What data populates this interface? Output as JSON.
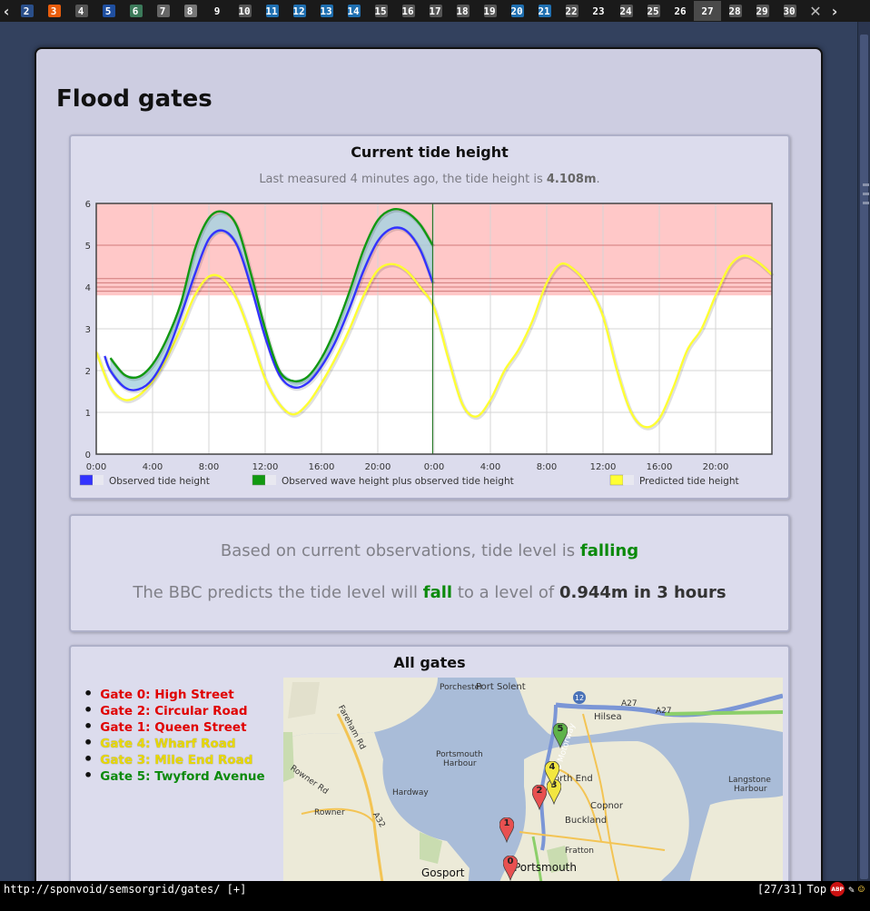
{
  "tabs": [
    {
      "num": "2",
      "fav": "#2a4f8a"
    },
    {
      "num": "3",
      "fav": "#e85d0c"
    },
    {
      "num": "4",
      "fav": "#555"
    },
    {
      "num": "5",
      "fav": "#1f4fa0"
    },
    {
      "num": "6",
      "fav": "#3c7a5a"
    },
    {
      "num": "7",
      "fav": "#666"
    },
    {
      "num": "8",
      "fav": "#777"
    },
    {
      "num": "9",
      "fav": ""
    },
    {
      "num": "10",
      "fav": "#555"
    },
    {
      "num": "11",
      "fav": "#1f6fb0"
    },
    {
      "num": "12",
      "fav": "#1f6fb0"
    },
    {
      "num": "13",
      "fav": "#1f6fb0"
    },
    {
      "num": "14",
      "fav": "#1f6fb0"
    },
    {
      "num": "15",
      "fav": "#555"
    },
    {
      "num": "16",
      "fav": "#555"
    },
    {
      "num": "17",
      "fav": "#555"
    },
    {
      "num": "18",
      "fav": "#555"
    },
    {
      "num": "19",
      "fav": "#555"
    },
    {
      "num": "20",
      "fav": "#1f6fb0"
    },
    {
      "num": "21",
      "fav": "#1f6fb0"
    },
    {
      "num": "22",
      "fav": "#555"
    },
    {
      "num": "23",
      "fav": ""
    },
    {
      "num": "24",
      "fav": "#555"
    },
    {
      "num": "25",
      "fav": "#555"
    },
    {
      "num": "26",
      "fav": ""
    },
    {
      "num": "27",
      "fav": "",
      "active": true
    },
    {
      "num": "28",
      "fav": "#555"
    },
    {
      "num": "29",
      "fav": "#555"
    },
    {
      "num": "30",
      "fav": "#555"
    }
  ],
  "page_title": "Flood gates",
  "tide": {
    "title": "Current tide height",
    "sub_prefix": "Last measured 4 minutes ago, the tide height is ",
    "sub_value": "4.108m",
    "sub_suffix": "."
  },
  "chart_data": {
    "type": "line",
    "ylim": [
      0,
      6
    ],
    "xlim": [
      0,
      48
    ],
    "x_unit": "hours from 0:00 on day 1",
    "xticks": [
      0,
      4,
      8,
      12,
      16,
      20,
      24,
      28,
      32,
      36,
      40,
      44
    ],
    "xtick_labels": [
      "0:00",
      "4:00",
      "8:00",
      "12:00",
      "16:00",
      "20:00",
      "0:00",
      "4:00",
      "8:00",
      "12:00",
      "16:00",
      "20:00"
    ],
    "yticks": [
      0,
      1,
      2,
      3,
      4,
      5,
      6
    ],
    "grid": true,
    "now_marker_x": 23.9,
    "danger_zone_from": 3.8,
    "threshold_lines": [
      5.0,
      4.2,
      4.1,
      4.0,
      3.9
    ],
    "legend_position": "bottom",
    "series": [
      {
        "name": "Predicted tide height",
        "color": "#ffff33",
        "x": [
          0,
          1,
          2,
          3,
          4,
          5,
          6,
          7,
          8,
          9,
          10,
          11,
          12,
          13,
          14,
          15,
          16,
          17,
          18,
          19,
          20,
          21,
          22,
          23,
          24,
          25,
          26,
          27,
          28,
          29,
          30,
          31,
          32,
          33,
          34,
          35,
          36,
          37,
          38,
          39,
          40,
          41,
          42,
          43,
          44,
          45,
          46,
          47,
          48
        ],
        "y": [
          2.45,
          1.6,
          1.3,
          1.4,
          1.75,
          2.3,
          3.0,
          3.8,
          4.25,
          4.2,
          3.7,
          2.8,
          1.8,
          1.2,
          0.95,
          1.2,
          1.7,
          2.3,
          3.0,
          3.8,
          4.4,
          4.55,
          4.4,
          4.0,
          3.5,
          2.3,
          1.2,
          0.9,
          1.3,
          2.0,
          2.5,
          3.2,
          4.1,
          4.55,
          4.4,
          4.0,
          3.3,
          2.0,
          1.0,
          0.65,
          0.85,
          1.6,
          2.5,
          3.0,
          3.8,
          4.5,
          4.75,
          4.6,
          4.3
        ]
      },
      {
        "name": "Observed tide height",
        "color": "#3333ff",
        "x": [
          0.6,
          1,
          2,
          3,
          4,
          5,
          6,
          7,
          8,
          9,
          10,
          11,
          12,
          13,
          14,
          15,
          16,
          17,
          18,
          19,
          20,
          21,
          22,
          23,
          23.9
        ],
        "y": [
          2.35,
          2.0,
          1.6,
          1.55,
          1.8,
          2.4,
          3.3,
          4.3,
          5.15,
          5.35,
          5.0,
          4.0,
          2.8,
          1.9,
          1.6,
          1.7,
          2.1,
          2.7,
          3.5,
          4.4,
          5.1,
          5.4,
          5.35,
          4.9,
          4.108
        ]
      },
      {
        "name": "Observed wave height plus observed tide height",
        "color": "#119911",
        "x": [
          1,
          2,
          3,
          4,
          5,
          6,
          7,
          8,
          9,
          10,
          11,
          12,
          13,
          14,
          15,
          16,
          17,
          18,
          19,
          20,
          21,
          22,
          23,
          23.9
        ],
        "y": [
          2.3,
          1.9,
          1.85,
          2.15,
          2.75,
          3.6,
          4.9,
          5.65,
          5.8,
          5.45,
          4.3,
          3.0,
          2.0,
          1.75,
          1.85,
          2.3,
          3.0,
          3.9,
          4.9,
          5.6,
          5.85,
          5.8,
          5.5,
          5.0
        ]
      }
    ],
    "legend": [
      {
        "label": "Observed tide height",
        "color": "#3333ff"
      },
      {
        "label": "Observed wave height plus observed tide height",
        "color": "#119911"
      },
      {
        "label": "Predicted tide height",
        "color": "#ffff33"
      }
    ]
  },
  "status": {
    "line1_prefix": "Based on current observations, tide level is ",
    "line1_value": "falling",
    "line2_prefix": "The BBC predicts the tide level will ",
    "line2_verb": "fall",
    "line2_middle": " to a level of ",
    "line2_value": "0.944m in 3 hours"
  },
  "gates": {
    "title": "All gates",
    "items": [
      {
        "label": "Gate 0: High Street",
        "status": "red",
        "color": "#e00000"
      },
      {
        "label": "Gate 2: Circular Road",
        "status": "red",
        "color": "#e00000"
      },
      {
        "label": "Gate 1: Queen Street",
        "status": "red",
        "color": "#e00000"
      },
      {
        "label": "Gate 4: Wharf Road",
        "status": "yellow",
        "color": "#e8d800"
      },
      {
        "label": "Gate 3: Mile End Road",
        "status": "yellow",
        "color": "#e8d800"
      },
      {
        "label": "Gate 5: Twyford Avenue",
        "status": "green",
        "color": "#0b8a0b"
      }
    ],
    "map_labels": {
      "porchester": "Porchester",
      "port_solent": "Port Solent",
      "hilsea": "Hilsea",
      "harbour1": "Portsmouth",
      "harbour2": "Harbour",
      "north_end": "orth End",
      "langstone1": "Langstone",
      "langstone2": "Harbour",
      "copnor": "Copnor",
      "hardway": "Hardway",
      "rowner": "Rowner",
      "rowner_rd": "Rowner Rd",
      "fareham_rd": "Fareham Rd",
      "buckland": "Buckland",
      "fratton": "Fratton",
      "gosport": "Gosport",
      "portsmouth": "Portsmouth",
      "a27": "A27",
      "a32": "A32",
      "m275": "M275 Motorway",
      "road_12": "12"
    },
    "markers": [
      {
        "label": "0",
        "color": "#e85050"
      },
      {
        "label": "1",
        "color": "#e85050"
      },
      {
        "label": "2",
        "color": "#e85050"
      },
      {
        "label": "3",
        "color": "#f2e640"
      },
      {
        "label": "4",
        "color": "#f2e640"
      },
      {
        "label": "5",
        "color": "#5fb34a"
      }
    ]
  },
  "statusbar": {
    "url": "http://sponvoid/semsorgrid/gates/ [+]",
    "position": "[27/31]",
    "scroll": "Top",
    "abp": "ABP"
  }
}
